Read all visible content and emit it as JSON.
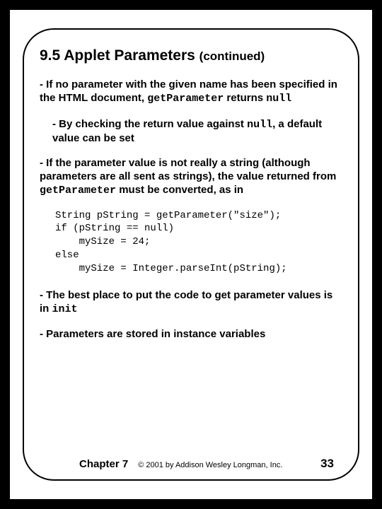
{
  "title": {
    "main": "9.5 Applet Parameters",
    "cont": "(continued)"
  },
  "bullets": {
    "b1": {
      "pre": "- If no parameter with the given name has been specified in the HTML document, ",
      "code1": "getParameter",
      "mid": " returns ",
      "code2": "null"
    },
    "b2": {
      "pre": "- By checking the return value against ",
      "code1": "null",
      "post": ", a default value can be set"
    },
    "b3": {
      "pre": "- If the parameter value is not really a string (although parameters are all sent as strings), the value returned from ",
      "code1": "getParameter",
      "post": " must be converted, as in"
    },
    "b4": {
      "pre": "- The best place to put the code to get parameter values is in ",
      "code1": "init"
    },
    "b5": {
      "text": "- Parameters are stored in instance variables"
    }
  },
  "code": "String pString = getParameter(\"size\");\nif (pString == null)\n    mySize = 24;\nelse\n    mySize = Integer.parseInt(pString);",
  "footer": {
    "chapter": "Chapter 7",
    "copyright": "© 2001 by Addison Wesley Longman, Inc.",
    "page": "33"
  }
}
